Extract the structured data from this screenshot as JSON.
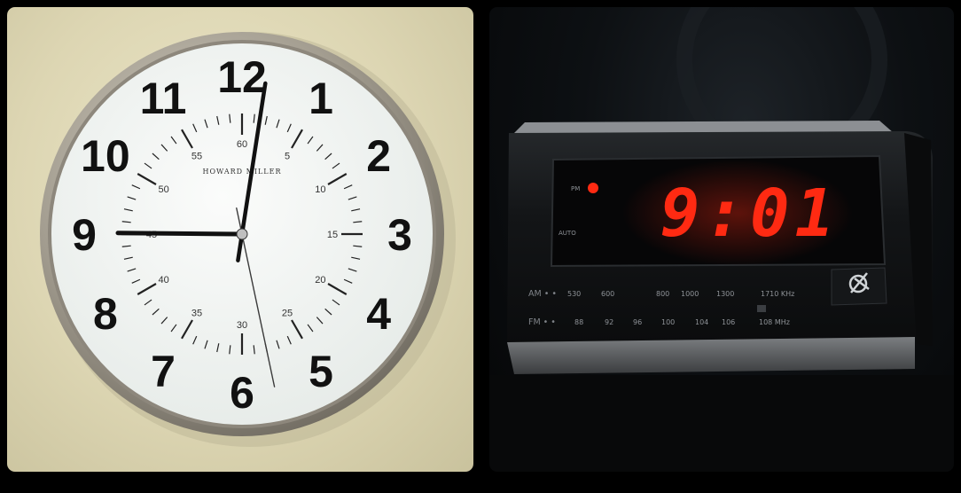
{
  "wall_clock": {
    "brand": "HOWARD MILLER",
    "hour_numerals": [
      "12",
      "1",
      "2",
      "3",
      "4",
      "5",
      "6",
      "7",
      "8",
      "9",
      "10",
      "11"
    ],
    "minute_numerals": [
      "60",
      "5",
      "10",
      "15",
      "20",
      "25",
      "30",
      "35",
      "40",
      "45",
      "50",
      "55"
    ],
    "time": {
      "hour": 9,
      "minute": 1,
      "second": 28
    },
    "colors": {
      "wall": "#e2dcbc",
      "face": "#f4f6f4",
      "bezel": "#a9a294",
      "hands": "#111111"
    }
  },
  "alarm_clock": {
    "display": "9:01",
    "pm_label": "PM",
    "auto_label": "AUTO",
    "am_band": {
      "label": "AM • •",
      "stops": [
        "530",
        "600",
        "800",
        "1000",
        "1300",
        "1710 KHz"
      ]
    },
    "fm_band": {
      "label": "FM • •",
      "stops": [
        "88",
        "92",
        "96",
        "100",
        "104",
        "106",
        "108 MHz"
      ]
    },
    "colors": {
      "digits": "#ff2a12",
      "body": "#121416",
      "base": "#5a5d60"
    }
  }
}
